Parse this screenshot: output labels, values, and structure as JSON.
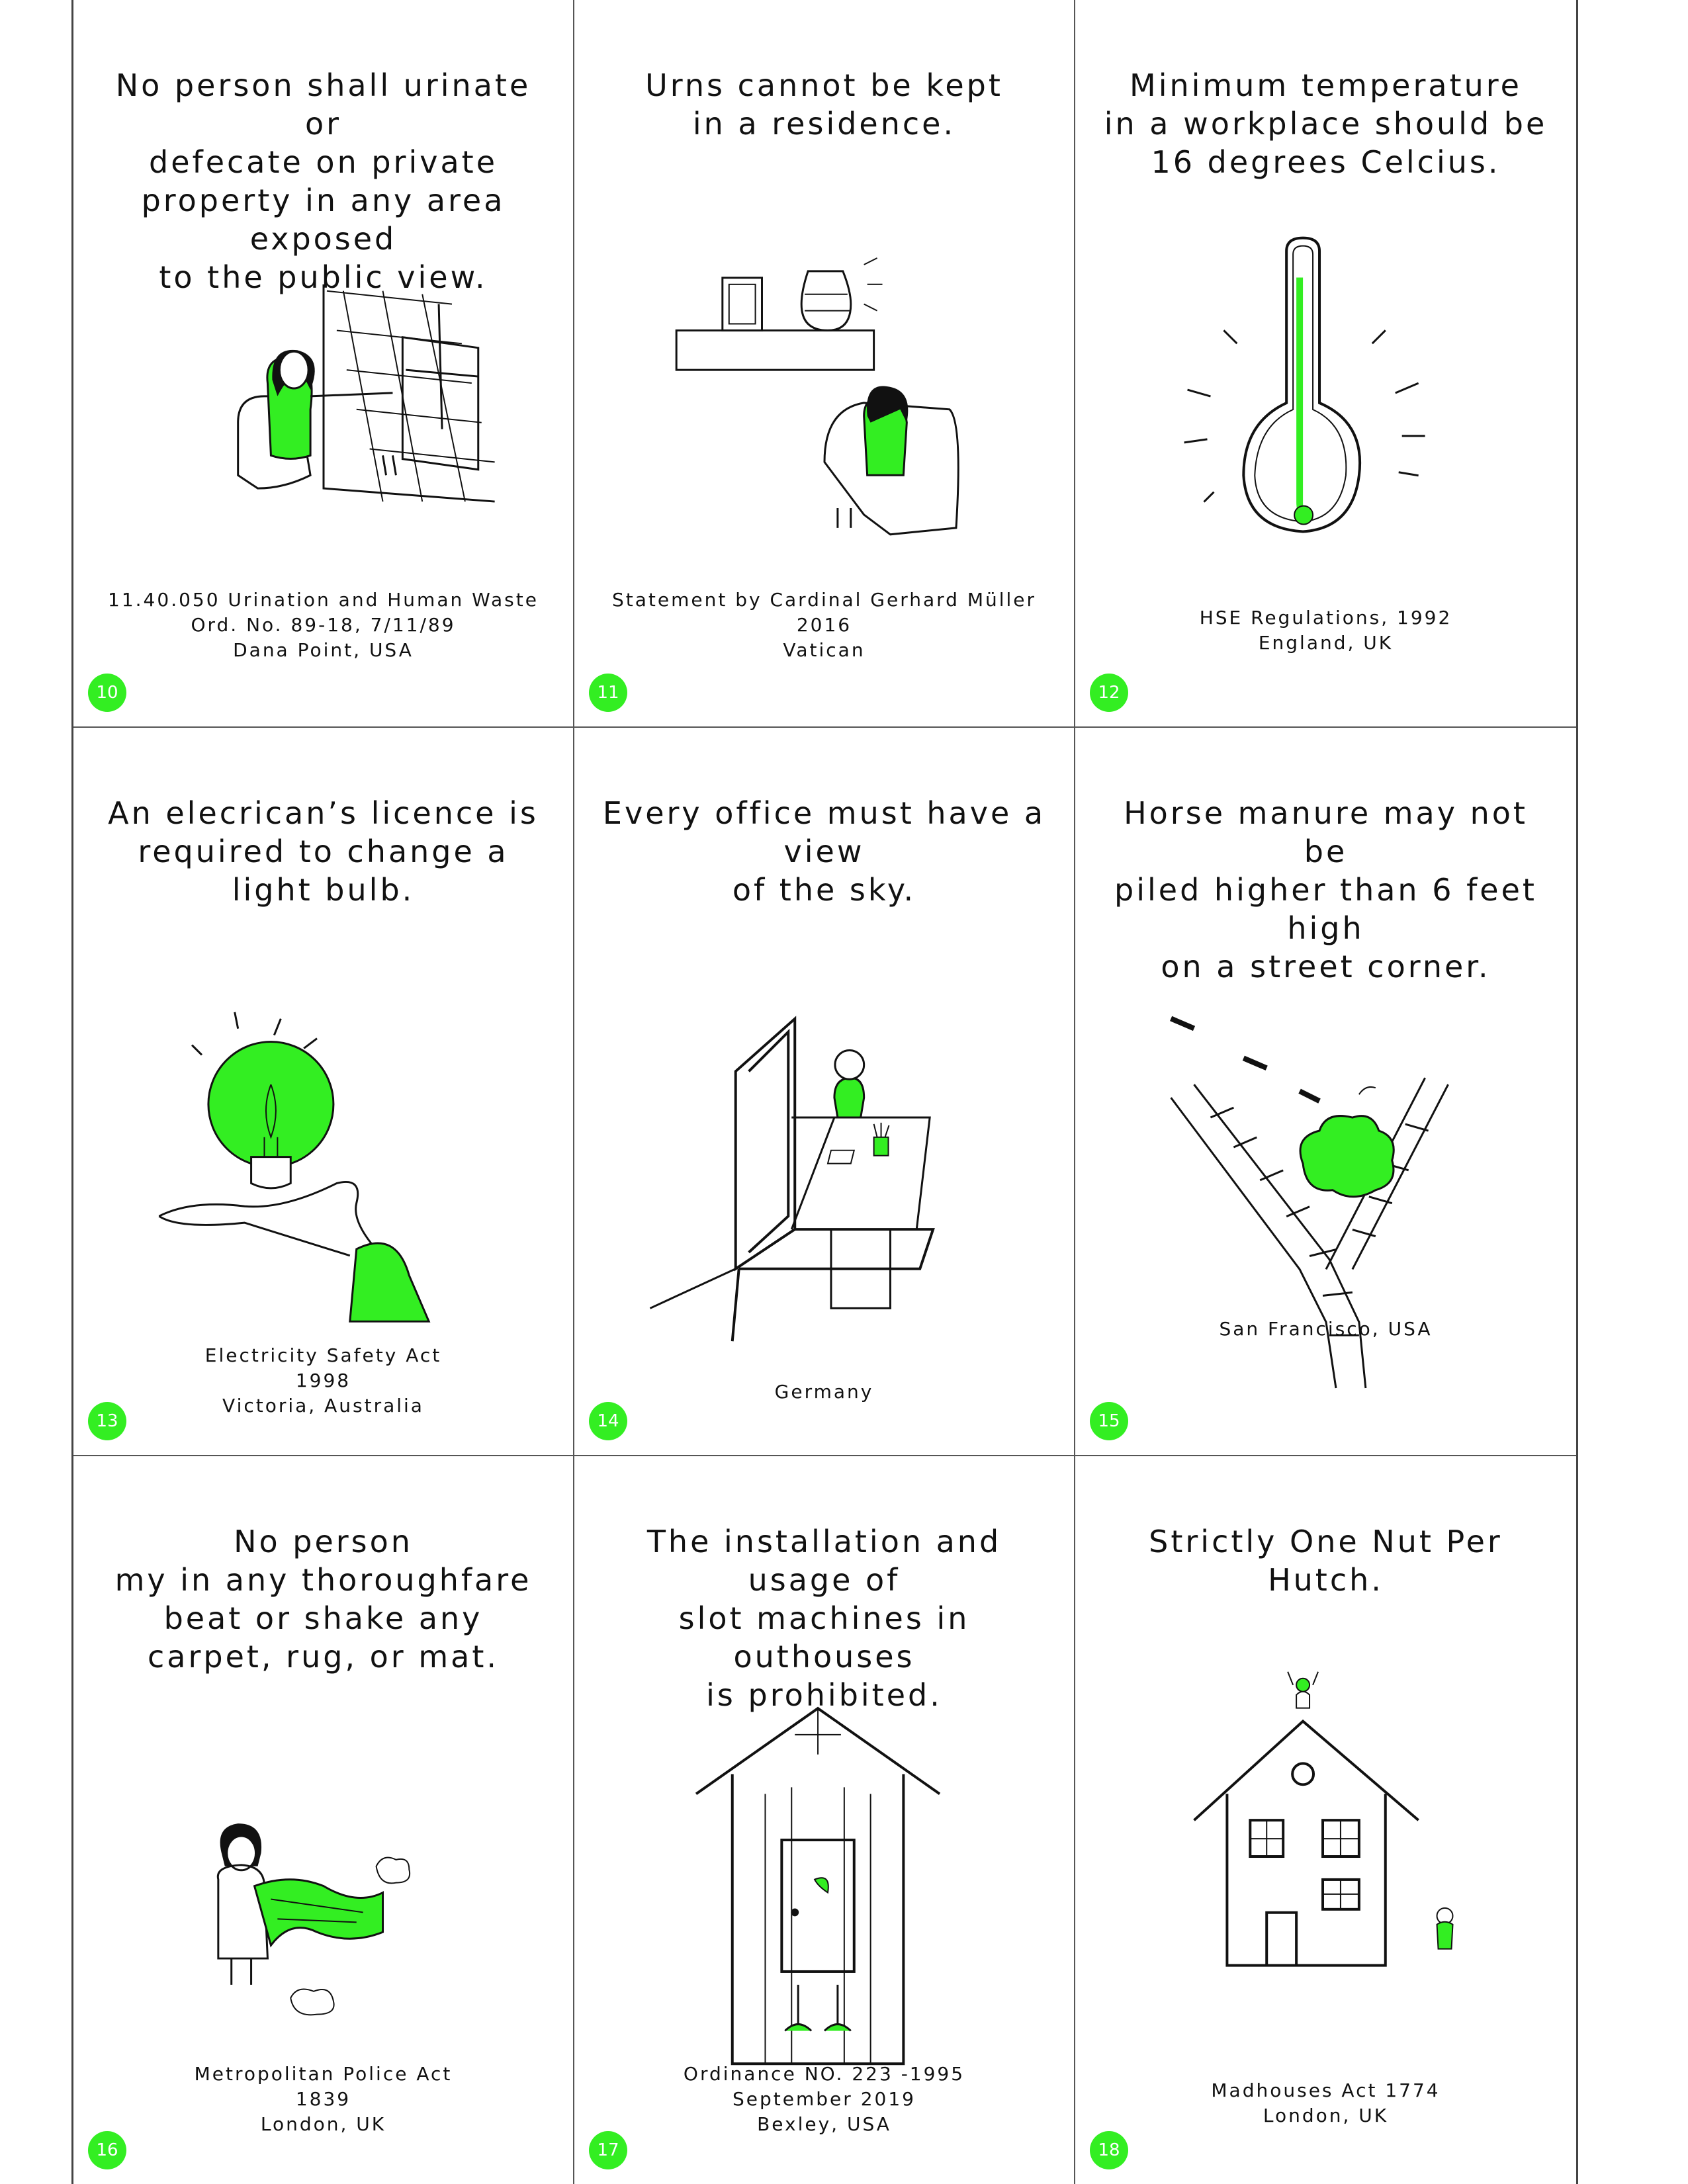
{
  "colors": {
    "accent": "#33ee22",
    "ink": "#111111"
  },
  "cards": [
    {
      "number": "10",
      "caption": "No person shall urinate or\ndefecate on private\nproperty in any area exposed\nto the public view.",
      "source": "11.40.050 Urination and Human Waste\nOrd. No. 89-18, 7/11/89\nDana Point, USA",
      "illustration": "person-in-armchair-by-window"
    },
    {
      "number": "11",
      "caption": "Urns cannot be kept\nin a residence.",
      "source": "Statement by Cardinal Gerhard Müller\n2016\nVatican",
      "illustration": "urn-on-shelf-with-person-in-chair"
    },
    {
      "number": "12",
      "caption": "Minimum temperature\nin a workplace should be\n16 degrees Celcius.",
      "source": "HSE Regulations, 1992\nEngland, UK",
      "illustration": "thermometer"
    },
    {
      "number": "13",
      "caption": "An elecrican’s licence is\nrequired to change a\nlight bulb.",
      "source": "Electricity Safety Act\n1998\nVictoria, Australia",
      "illustration": "hand-holding-light-bulb"
    },
    {
      "number": "14",
      "caption": "Every office must have a view\nof the sky.",
      "source": "Germany",
      "illustration": "person-at-desk-by-window"
    },
    {
      "number": "15",
      "caption": "Horse manure may not be\npiled higher than 6 feet high\non a street corner.",
      "source": "San Francisco, USA",
      "illustration": "manure-pile-on-street-corner"
    },
    {
      "number": "16",
      "caption": "No person\nmy in any thoroughfare\nbeat or shake any\ncarpet, rug, or mat.",
      "source": "Metropolitan Police Act\n1839\nLondon, UK",
      "illustration": "person-shaking-rug"
    },
    {
      "number": "17",
      "caption": "The installation and usage of\nslot machines in outhouses\nis prohibited.",
      "source": "Ordinance NO. 223 -1995\nSeptember 2019\nBexley, USA",
      "illustration": "outhouse"
    },
    {
      "number": "18",
      "caption": "Strictly One Nut Per Hutch.",
      "source": "Madhouses Act 1774\nLondon, UK",
      "illustration": "house-with-person-on-roof"
    }
  ]
}
